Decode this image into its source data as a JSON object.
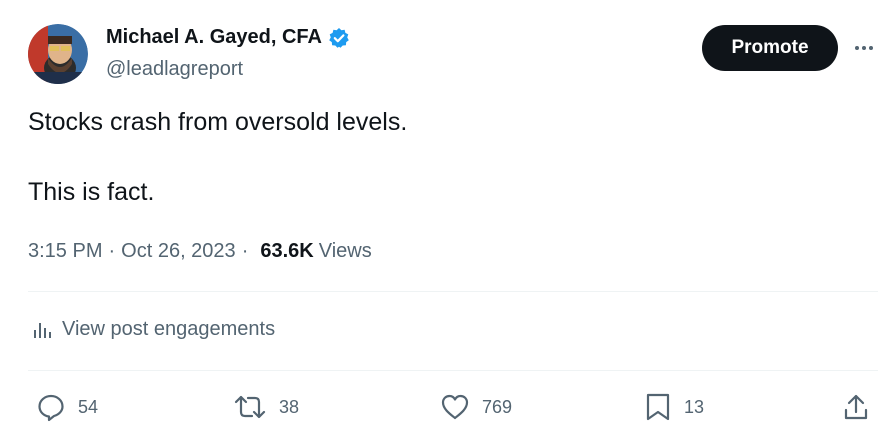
{
  "author": {
    "display_name": "Michael A. Gayed, CFA",
    "handle": "@leadlagreport"
  },
  "header": {
    "promote_label": "Promote"
  },
  "tweet": {
    "line1": "Stocks crash from oversold levels.",
    "line2": "This is fact."
  },
  "meta": {
    "time": "3:15 PM",
    "separator": "·",
    "date": "Oct 26, 2023",
    "views_count": "63.6K",
    "views_label": "Views"
  },
  "engagements_label": "View post engagements",
  "actions": {
    "replies": "54",
    "reposts": "38",
    "likes": "769",
    "bookmarks": "13"
  },
  "colors": {
    "text_primary": "#0f1419",
    "text_secondary": "#536471",
    "verified_blue": "#1d9bf0",
    "button_bg": "#0f1419"
  }
}
